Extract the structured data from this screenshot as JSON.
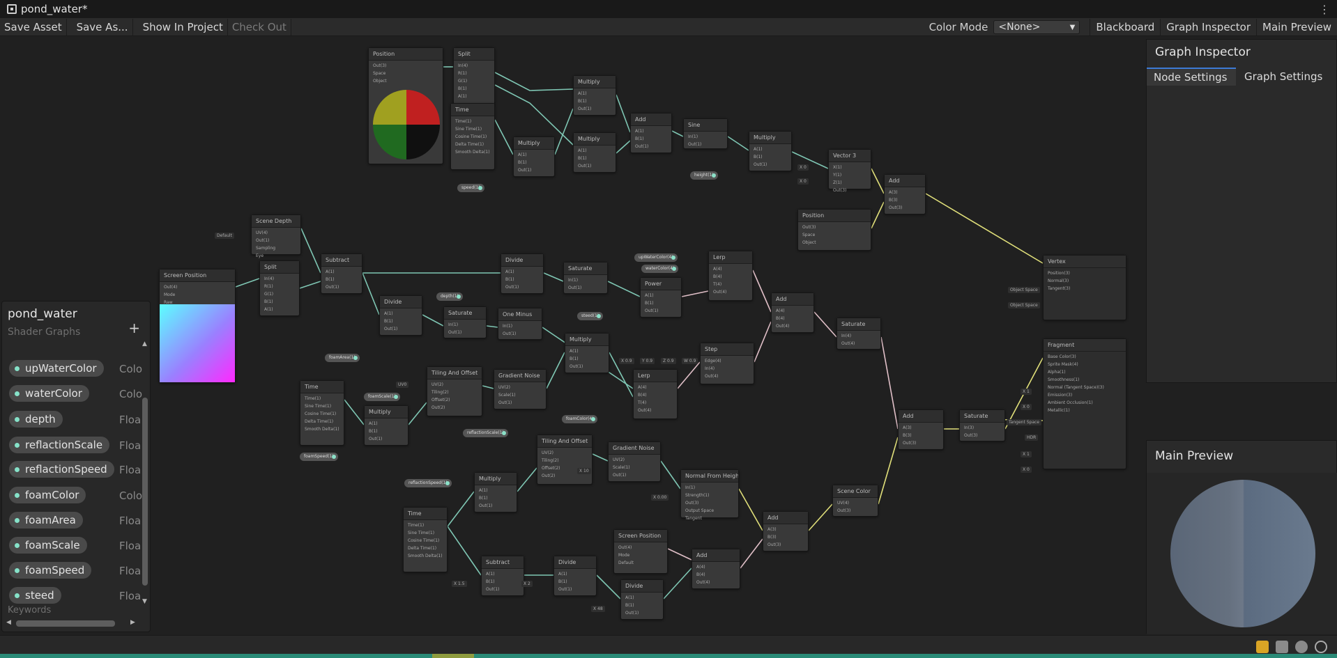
{
  "window": {
    "title": "pond_water*"
  },
  "toolbar": {
    "save_asset": "Save Asset",
    "save_as": "Save As...",
    "show_in_project": "Show In Project",
    "check_out": "Check Out",
    "color_mode_label": "Color Mode",
    "color_mode_value": "<None>",
    "blackboard": "Blackboard",
    "graph_inspector": "Graph Inspector",
    "main_preview": "Main Preview"
  },
  "blackboard": {
    "title": "pond_water",
    "subtitle": "Shader Graphs",
    "add": "+",
    "keywords_label": "Keywords",
    "items": [
      {
        "name": "upWaterColor",
        "type": "Colo"
      },
      {
        "name": "waterColor",
        "type": "Colo"
      },
      {
        "name": "depth",
        "type": "Floa"
      },
      {
        "name": "reflactionScale",
        "type": "Floa"
      },
      {
        "name": "reflactionSpeed",
        "type": "Floa"
      },
      {
        "name": "foamColor",
        "type": "Colo"
      },
      {
        "name": "foamArea",
        "type": "Floa"
      },
      {
        "name": "foamScale",
        "type": "Floa"
      },
      {
        "name": "foamSpeed",
        "type": "Floa"
      },
      {
        "name": "steed",
        "type": "Floa"
      }
    ]
  },
  "inspector": {
    "title": "Graph Inspector",
    "tabs": [
      "Node Settings",
      "Graph Settings"
    ]
  },
  "preview": {
    "title": "Main Preview"
  },
  "graph": {
    "nodes": [
      {
        "id": "position1",
        "title": "Position",
        "ports": [
          "Out(3)",
          "Space",
          "Object"
        ]
      },
      {
        "id": "split1",
        "title": "Split",
        "ports": [
          "In(4)",
          "R(1)",
          "G(1)",
          "B(1)",
          "A(1)"
        ]
      },
      {
        "id": "time1",
        "title": "Time",
        "ports": [
          "Time(1)",
          "Sine Time(1)",
          "Cosine Time(1)",
          "Delta Time(1)",
          "Smooth Delta(1)"
        ]
      },
      {
        "id": "mul1",
        "title": "Multiply",
        "ports": [
          "A(1)",
          "B(1)",
          "Out(1)"
        ]
      },
      {
        "id": "mul2",
        "title": "Multiply",
        "ports": [
          "A(1)",
          "B(1)",
          "Out(1)"
        ]
      },
      {
        "id": "mul3",
        "title": "Multiply",
        "ports": [
          "A(1)",
          "B(1)",
          "Out(1)"
        ]
      },
      {
        "id": "add1",
        "title": "Add",
        "ports": [
          "A(1)",
          "B(1)",
          "Out(1)"
        ]
      },
      {
        "id": "sine",
        "title": "Sine",
        "ports": [
          "In(1)",
          "Out(1)"
        ]
      },
      {
        "id": "mul4",
        "title": "Multiply",
        "ports": [
          "A(1)",
          "B(1)",
          "Out(1)"
        ]
      },
      {
        "id": "vec3",
        "title": "Vector 3",
        "ports": [
          "X(1)",
          "Y(1)",
          "Z(1)",
          "Out(3)"
        ]
      },
      {
        "id": "add2",
        "title": "Add",
        "ports": [
          "A(3)",
          "B(3)",
          "Out(3)"
        ]
      },
      {
        "id": "position2",
        "title": "Position",
        "ports": [
          "Out(3)",
          "Space",
          "Object"
        ]
      },
      {
        "id": "scenedepth",
        "title": "Scene Depth",
        "ports": [
          "UV(4)",
          "Out(1)",
          "Sampling",
          "Eye"
        ]
      },
      {
        "id": "screenpos1",
        "title": "Screen Position",
        "ports": [
          "Out(4)",
          "Mode",
          "Raw"
        ]
      },
      {
        "id": "split2",
        "title": "Split",
        "ports": [
          "In(4)",
          "R(1)",
          "G(1)",
          "B(1)",
          "A(1)"
        ]
      },
      {
        "id": "subtract1",
        "title": "Subtract",
        "ports": [
          "A(1)",
          "B(1)",
          "Out(1)"
        ]
      },
      {
        "id": "divide1",
        "title": "Divide",
        "ports": [
          "A(1)",
          "B(1)",
          "Out(1)"
        ]
      },
      {
        "id": "saturate1",
        "title": "Saturate",
        "ports": [
          "In(1)",
          "Out(1)"
        ]
      },
      {
        "id": "divide2",
        "title": "Divide",
        "ports": [
          "A(1)",
          "B(1)",
          "Out(1)"
        ]
      },
      {
        "id": "saturate2",
        "title": "Saturate",
        "ports": [
          "In(1)",
          "Out(1)"
        ]
      },
      {
        "id": "oneminus",
        "title": "One Minus",
        "ports": [
          "In(1)",
          "Out(1)"
        ]
      },
      {
        "id": "lerp1",
        "title": "Lerp",
        "ports": [
          "A(4)",
          "B(4)",
          "T(4)",
          "Out(4)"
        ]
      },
      {
        "id": "power",
        "title": "Power",
        "ports": [
          "A(1)",
          "B(1)",
          "Out(1)"
        ]
      },
      {
        "id": "add3",
        "title": "Add",
        "ports": [
          "A(4)",
          "B(4)",
          "Out(4)"
        ]
      },
      {
        "id": "saturate3",
        "title": "Saturate",
        "ports": [
          "In(4)",
          "Out(4)"
        ]
      },
      {
        "id": "mul5",
        "title": "Multiply",
        "ports": [
          "A(1)",
          "B(1)",
          "Out(1)"
        ]
      },
      {
        "id": "step",
        "title": "Step",
        "ports": [
          "Edge(4)",
          "In(4)",
          "Out(4)"
        ]
      },
      {
        "id": "lerp2",
        "title": "Lerp",
        "ports": [
          "A(4)",
          "B(4)",
          "T(4)",
          "Out(4)"
        ]
      },
      {
        "id": "tiling1",
        "title": "Tiling And Offset",
        "ports": [
          "UV(2)",
          "Tiling(2)",
          "Offset(2)",
          "Out(2)"
        ]
      },
      {
        "id": "noise1",
        "title": "Gradient Noise",
        "ports": [
          "UV(2)",
          "Scale(1)",
          "Out(1)"
        ]
      },
      {
        "id": "time2",
        "title": "Time",
        "ports": [
          "Time(1)",
          "Sine Time(1)",
          "Cosine Time(1)",
          "Delta Time(1)",
          "Smooth Delta(1)"
        ]
      },
      {
        "id": "mul6",
        "title": "Multiply",
        "ports": [
          "A(1)",
          "B(1)",
          "Out(1)"
        ]
      },
      {
        "id": "tiling2",
        "title": "Tiling And Offset",
        "ports": [
          "UV(2)",
          "Tiling(2)",
          "Offset(2)",
          "Out(2)"
        ]
      },
      {
        "id": "noise2",
        "title": "Gradient Noise",
        "ports": [
          "UV(2)",
          "Scale(1)",
          "Out(1)"
        ]
      },
      {
        "id": "normalheight",
        "title": "Normal From Height",
        "ports": [
          "In(1)",
          "Strength(1)",
          "Out(3)",
          "Output Space",
          "Tangent"
        ]
      },
      {
        "id": "mul7",
        "title": "Multiply",
        "ports": [
          "A(1)",
          "B(1)",
          "Out(1)"
        ]
      },
      {
        "id": "time3",
        "title": "Time",
        "ports": [
          "Time(1)",
          "Sine Time(1)",
          "Cosine Time(1)",
          "Delta Time(1)",
          "Smooth Delta(1)"
        ]
      },
      {
        "id": "subtract2",
        "title": "Subtract",
        "ports": [
          "A(1)",
          "B(1)",
          "Out(1)"
        ]
      },
      {
        "id": "divide3",
        "title": "Divide",
        "ports": [
          "A(1)",
          "B(1)",
          "Out(1)"
        ]
      },
      {
        "id": "divide4",
        "title": "Divide",
        "ports": [
          "A(1)",
          "B(1)",
          "Out(1)"
        ]
      },
      {
        "id": "screenpos2",
        "title": "Screen Position",
        "ports": [
          "Out(4)",
          "Mode",
          "Default"
        ]
      },
      {
        "id": "add4",
        "title": "Add",
        "ports": [
          "A(4)",
          "B(4)",
          "Out(4)"
        ]
      },
      {
        "id": "add5",
        "title": "Add",
        "ports": [
          "A(3)",
          "B(3)",
          "Out(3)"
        ]
      },
      {
        "id": "scenecolor",
        "title": "Scene Color",
        "ports": [
          "UV(4)",
          "Out(3)"
        ]
      },
      {
        "id": "add6",
        "title": "Add",
        "ports": [
          "A(3)",
          "B(3)",
          "Out(3)"
        ]
      },
      {
        "id": "saturate4",
        "title": "Saturate",
        "ports": [
          "In(3)",
          "Out(3)"
        ]
      },
      {
        "id": "vertex",
        "title": "Vertex",
        "ports": [
          "Position(3)",
          "Normal(3)",
          "Tangent(3)"
        ]
      },
      {
        "id": "fragment",
        "title": "Fragment",
        "ports": [
          "Base Color(3)",
          "Sprite Mask(4)",
          "Alpha(1)",
          "Smoothness(1)",
          "Normal (Tangent Space)(3)",
          "Emission(3)",
          "Ambient Occlusion(1)",
          "Metallic(1)"
        ]
      }
    ],
    "properties": [
      "speed(1)",
      "height(1)",
      "depth(1)",
      "foamArea(1)",
      "upWaterColor(4)",
      "waterColor(4)",
      "steed(1)",
      "foamScale(1)",
      "foamColor(4)",
      "foamSpeed(1)",
      "reflactionScale(1)",
      "reflactionSpeed(1)"
    ],
    "inline_values": [
      "Default",
      "X 0",
      "X 0",
      "X 0.9",
      "Y 0.9",
      "Z 0.9",
      "W 0.9",
      "UV0",
      "X 10",
      "X 0.00",
      "X 1.5",
      "X 2",
      "X 48",
      "Object Space",
      "Object Space",
      "Tangent Space",
      "X 1",
      "X 0",
      "X 1",
      "X 0",
      "HDR"
    ]
  }
}
